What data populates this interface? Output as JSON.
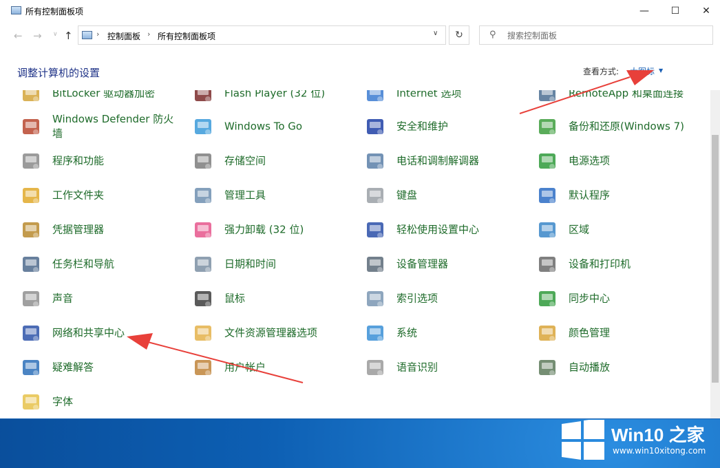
{
  "window": {
    "title": "所有控制面板项",
    "controls": {
      "minimize": "—",
      "maximize": "☐",
      "close": "✕"
    }
  },
  "nav": {
    "back": "←",
    "forward": "→",
    "history": "∨",
    "up": "↑",
    "breadcrumb": [
      "控制面板",
      "所有控制面板项"
    ],
    "separator": "›",
    "dropdown": "∨",
    "refresh": "↻"
  },
  "search": {
    "placeholder": "搜索控制面板",
    "value": ""
  },
  "header": {
    "title": "调整计算机的设置",
    "view_label": "查看方式:",
    "view_value": "大图标",
    "view_caret": "▼"
  },
  "items": [
    {
      "label": "BitLocker 驱动器加密",
      "icon": "bitlocker-icon"
    },
    {
      "label": "Flash Player (32 位)",
      "icon": "flash-icon"
    },
    {
      "label": "Internet 选项",
      "icon": "internet-options-icon"
    },
    {
      "label": "RemoteApp 和桌面连接",
      "icon": "remoteapp-icon"
    },
    {
      "label": "Windows Defender 防火墙",
      "icon": "firewall-icon"
    },
    {
      "label": "Windows To Go",
      "icon": "windows-to-go-icon"
    },
    {
      "label": "安全和维护",
      "icon": "flag-icon"
    },
    {
      "label": "备份和还原(Windows 7)",
      "icon": "backup-icon"
    },
    {
      "label": "程序和功能",
      "icon": "programs-icon"
    },
    {
      "label": "存储空间",
      "icon": "storage-icon"
    },
    {
      "label": "电话和调制解调器",
      "icon": "phone-icon"
    },
    {
      "label": "电源选项",
      "icon": "power-icon"
    },
    {
      "label": "工作文件夹",
      "icon": "work-folder-icon"
    },
    {
      "label": "管理工具",
      "icon": "admin-tools-icon"
    },
    {
      "label": "键盘",
      "icon": "keyboard-icon"
    },
    {
      "label": "默认程序",
      "icon": "default-programs-icon"
    },
    {
      "label": "凭据管理器",
      "icon": "credential-icon"
    },
    {
      "label": "强力卸载 (32 位)",
      "icon": "uninstall-icon"
    },
    {
      "label": "轻松使用设置中心",
      "icon": "accessibility-icon"
    },
    {
      "label": "区域",
      "icon": "region-icon"
    },
    {
      "label": "任务栏和导航",
      "icon": "taskbar-icon"
    },
    {
      "label": "日期和时间",
      "icon": "datetime-icon"
    },
    {
      "label": "设备管理器",
      "icon": "device-manager-icon"
    },
    {
      "label": "设备和打印机",
      "icon": "printer-icon"
    },
    {
      "label": "声音",
      "icon": "sound-icon"
    },
    {
      "label": "鼠标",
      "icon": "mouse-icon"
    },
    {
      "label": "索引选项",
      "icon": "indexing-icon"
    },
    {
      "label": "同步中心",
      "icon": "sync-icon"
    },
    {
      "label": "网络和共享中心",
      "icon": "network-icon"
    },
    {
      "label": "文件资源管理器选项",
      "icon": "folder-options-icon"
    },
    {
      "label": "系统",
      "icon": "system-icon"
    },
    {
      "label": "颜色管理",
      "icon": "color-icon"
    },
    {
      "label": "疑难解答",
      "icon": "troubleshoot-icon"
    },
    {
      "label": "用户帐户",
      "icon": "user-accounts-icon"
    },
    {
      "label": "语音识别",
      "icon": "microphone-icon"
    },
    {
      "label": "自动播放",
      "icon": "autoplay-icon"
    },
    {
      "label": "字体",
      "icon": "fonts-icon"
    }
  ],
  "watermark": {
    "brand_main": "Win10",
    "brand_suffix": " 之家",
    "url": "www.win10xitong.com"
  },
  "colors": {
    "item_text": "#1e6b2a",
    "heading": "#1e3287",
    "link": "#1a5fb4",
    "annotation_arrow": "#e8403a"
  }
}
